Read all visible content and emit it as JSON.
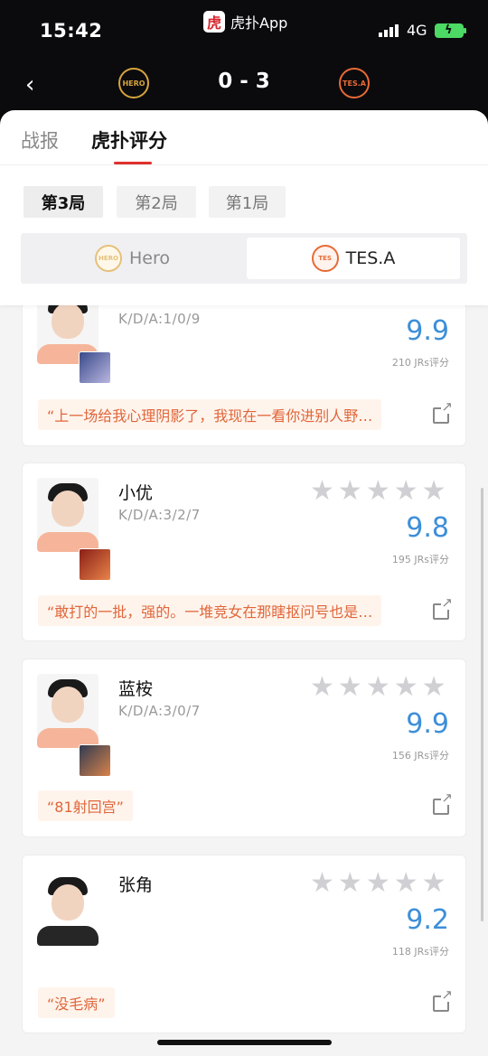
{
  "status": {
    "time": "15:42",
    "network": "4G",
    "app_name": "虎扑App",
    "app_logo_glyph": "虎"
  },
  "header": {
    "score": "0 - 3",
    "left_team_logo": "hero-logo",
    "right_team_logo": "tes-logo"
  },
  "tabs": [
    {
      "label": "战报"
    },
    {
      "label": "虎扑评分",
      "active": true
    }
  ],
  "games": [
    {
      "label": "第3局",
      "active": true
    },
    {
      "label": "第2局"
    },
    {
      "label": "第1局"
    }
  ],
  "teams": [
    {
      "label": "Hero"
    },
    {
      "label": "TES.A",
      "active": true
    }
  ],
  "players": [
    {
      "name": "",
      "kda": "K/D/A:1/0/9",
      "score": "9.9",
      "raters": "210 JRs评分",
      "comment": "“上一场给我心理阴影了，我现在一看你进别人野…"
    },
    {
      "name": "小优",
      "kda": "K/D/A:3/2/7",
      "score": "9.8",
      "raters": "195 JRs评分",
      "comment": "“敢打的一批，强的。一堆竞女在那瞎抠问号也是…"
    },
    {
      "name": "蓝桉",
      "kda": "K/D/A:3/0/7",
      "score": "9.9",
      "raters": "156 JRs评分",
      "comment": "“81射回宫”"
    },
    {
      "name": "张角",
      "kda": "",
      "score": "9.2",
      "raters": "118 JRs评分",
      "comment": "“没毛病”"
    }
  ],
  "colors": {
    "accent_red": "#e0302e",
    "score_blue": "#3d8fd8",
    "comment_orange": "#e0663a"
  }
}
